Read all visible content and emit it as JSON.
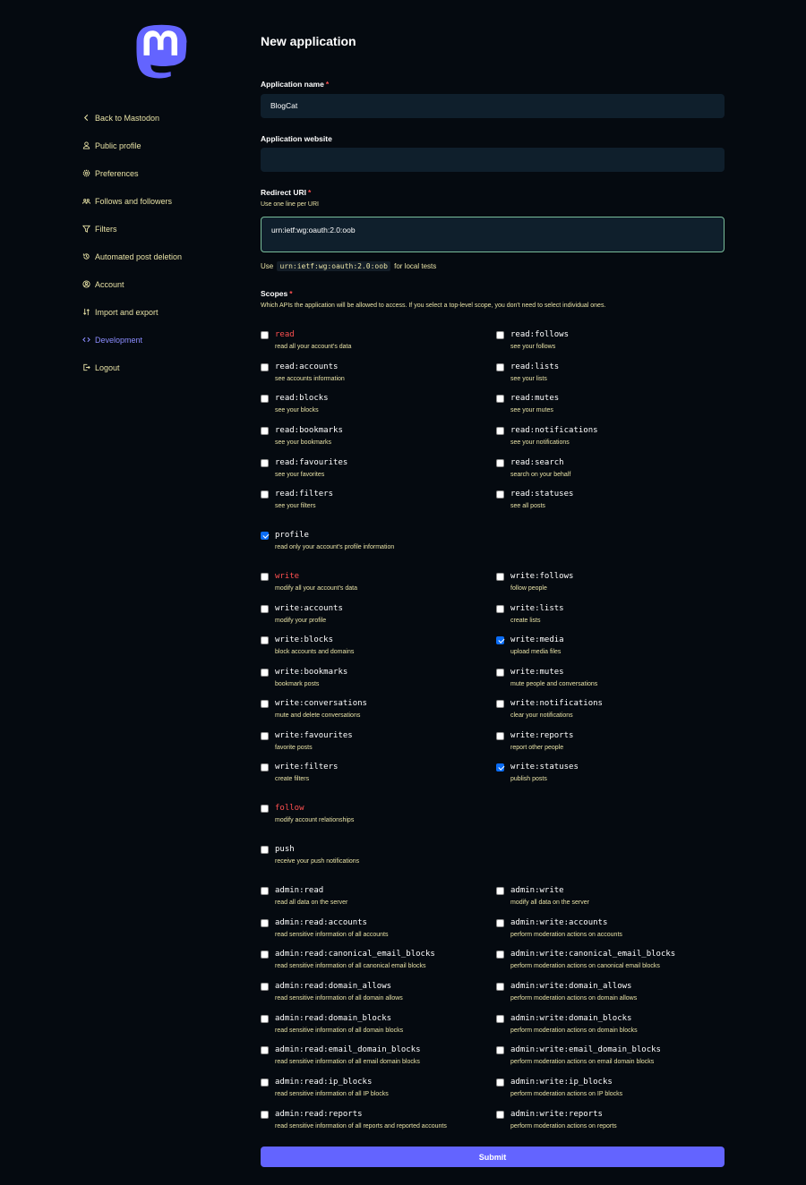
{
  "colors": {
    "background": "#050a10",
    "accent": "#6364ff",
    "hint_text": "#e8e2a6",
    "danger": "#ff5050",
    "checkbox_checked": "#0a6cf5"
  },
  "logo": {
    "icon": "mastodon-logo"
  },
  "sidebar": {
    "items": [
      {
        "label": "Back to Mastodon",
        "icon": "chevron-left-icon"
      },
      {
        "label": "Public profile",
        "icon": "user-icon"
      },
      {
        "label": "Preferences",
        "icon": "gear-icon"
      },
      {
        "label": "Follows and followers",
        "icon": "people-icon"
      },
      {
        "label": "Filters",
        "icon": "filter-icon"
      },
      {
        "label": "Automated post deletion",
        "icon": "history-icon"
      },
      {
        "label": "Account",
        "icon": "account-circle-icon"
      },
      {
        "label": "Import and export",
        "icon": "import-export-icon"
      },
      {
        "label": "Development",
        "icon": "code-icon",
        "active": true
      },
      {
        "label": "Logout",
        "icon": "logout-icon"
      }
    ]
  },
  "page": {
    "title": "New application"
  },
  "form": {
    "app_name": {
      "label": "Application name",
      "required_mark": "*",
      "value": "BlogCat"
    },
    "app_website": {
      "label": "Application website",
      "value": ""
    },
    "redirect_uri": {
      "label": "Redirect URI",
      "required_mark": "*",
      "hint": "Use one line per URI",
      "value": "urn:ietf:wg:oauth:2.0:oob",
      "use_prefix": "Use",
      "use_code": "urn:ietf:wg:oauth:2.0:oob",
      "use_suffix": "for local tests"
    },
    "scopes": {
      "label": "Scopes",
      "required_mark": "*",
      "hint": "Which APIs the application will be allowed to access. If you select a top-level scope, you don't need to select individual ones."
    },
    "submit_label": "Submit"
  },
  "scopes": [
    {
      "name": "read",
      "desc": "read all your account's data",
      "checked": false,
      "danger": true
    },
    {
      "name": "read:follows",
      "desc": "see your follows",
      "checked": false
    },
    {
      "name": "read:accounts",
      "desc": "see accounts information",
      "checked": false
    },
    {
      "name": "read:lists",
      "desc": "see your lists",
      "checked": false
    },
    {
      "name": "read:blocks",
      "desc": "see your blocks",
      "checked": false
    },
    {
      "name": "read:mutes",
      "desc": "see your mutes",
      "checked": false
    },
    {
      "name": "read:bookmarks",
      "desc": "see your bookmarks",
      "checked": false
    },
    {
      "name": "read:notifications",
      "desc": "see your notifications",
      "checked": false
    },
    {
      "name": "read:favourites",
      "desc": "see your favorites",
      "checked": false
    },
    {
      "name": "read:search",
      "desc": "search on your behalf",
      "checked": false
    },
    {
      "name": "read:filters",
      "desc": "see your filters",
      "checked": false
    },
    {
      "name": "read:statuses",
      "desc": "see all posts",
      "checked": false
    },
    {
      "name": "profile",
      "desc": "read only your account's profile information",
      "checked": true
    },
    {
      "name": "write",
      "desc": "modify all your account's data",
      "checked": false,
      "danger": true
    },
    {
      "name": "write:follows",
      "desc": "follow people",
      "checked": false
    },
    {
      "name": "write:accounts",
      "desc": "modify your profile",
      "checked": false
    },
    {
      "name": "write:lists",
      "desc": "create lists",
      "checked": false
    },
    {
      "name": "write:blocks",
      "desc": "block accounts and domains",
      "checked": false
    },
    {
      "name": "write:media",
      "desc": "upload media files",
      "checked": true
    },
    {
      "name": "write:bookmarks",
      "desc": "bookmark posts",
      "checked": false
    },
    {
      "name": "write:mutes",
      "desc": "mute people and conversations",
      "checked": false
    },
    {
      "name": "write:conversations",
      "desc": "mute and delete conversations",
      "checked": false
    },
    {
      "name": "write:notifications",
      "desc": "clear your notifications",
      "checked": false
    },
    {
      "name": "write:favourites",
      "desc": "favorite posts",
      "checked": false
    },
    {
      "name": "write:reports",
      "desc": "report other people",
      "checked": false
    },
    {
      "name": "write:filters",
      "desc": "create filters",
      "checked": false
    },
    {
      "name": "write:statuses",
      "desc": "publish posts",
      "checked": true
    },
    {
      "name": "follow",
      "desc": "modify account relationships",
      "checked": false,
      "danger": true
    },
    {
      "name": "push",
      "desc": "receive your push notifications",
      "checked": false
    },
    {
      "name": "admin:read",
      "desc": "read all data on the server",
      "checked": false
    },
    {
      "name": "admin:write",
      "desc": "modify all data on the server",
      "checked": false
    },
    {
      "name": "admin:read:accounts",
      "desc": "read sensitive information of all accounts",
      "checked": false
    },
    {
      "name": "admin:write:accounts",
      "desc": "perform moderation actions on accounts",
      "checked": false
    },
    {
      "name": "admin:read:canonical_email_blocks",
      "desc": "read sensitive information of all canonical email blocks",
      "checked": false
    },
    {
      "name": "admin:write:canonical_email_blocks",
      "desc": "perform moderation actions on canonical email blocks",
      "checked": false
    },
    {
      "name": "admin:read:domain_allows",
      "desc": "read sensitive information of all domain allows",
      "checked": false
    },
    {
      "name": "admin:write:domain_allows",
      "desc": "perform moderation actions on domain allows",
      "checked": false
    },
    {
      "name": "admin:read:domain_blocks",
      "desc": "read sensitive information of all domain blocks",
      "checked": false
    },
    {
      "name": "admin:write:domain_blocks",
      "desc": "perform moderation actions on domain blocks",
      "checked": false
    },
    {
      "name": "admin:read:email_domain_blocks",
      "desc": "read sensitive information of all email domain blocks",
      "checked": false
    },
    {
      "name": "admin:write:email_domain_blocks",
      "desc": "perform moderation actions on email domain blocks",
      "checked": false
    },
    {
      "name": "admin:read:ip_blocks",
      "desc": "read sensitive information of all IP blocks",
      "checked": false
    },
    {
      "name": "admin:write:ip_blocks",
      "desc": "perform moderation actions on IP blocks",
      "checked": false
    },
    {
      "name": "admin:read:reports",
      "desc": "read sensitive information of all reports and reported accounts",
      "checked": false
    },
    {
      "name": "admin:write:reports",
      "desc": "perform moderation actions on reports",
      "checked": false
    }
  ]
}
